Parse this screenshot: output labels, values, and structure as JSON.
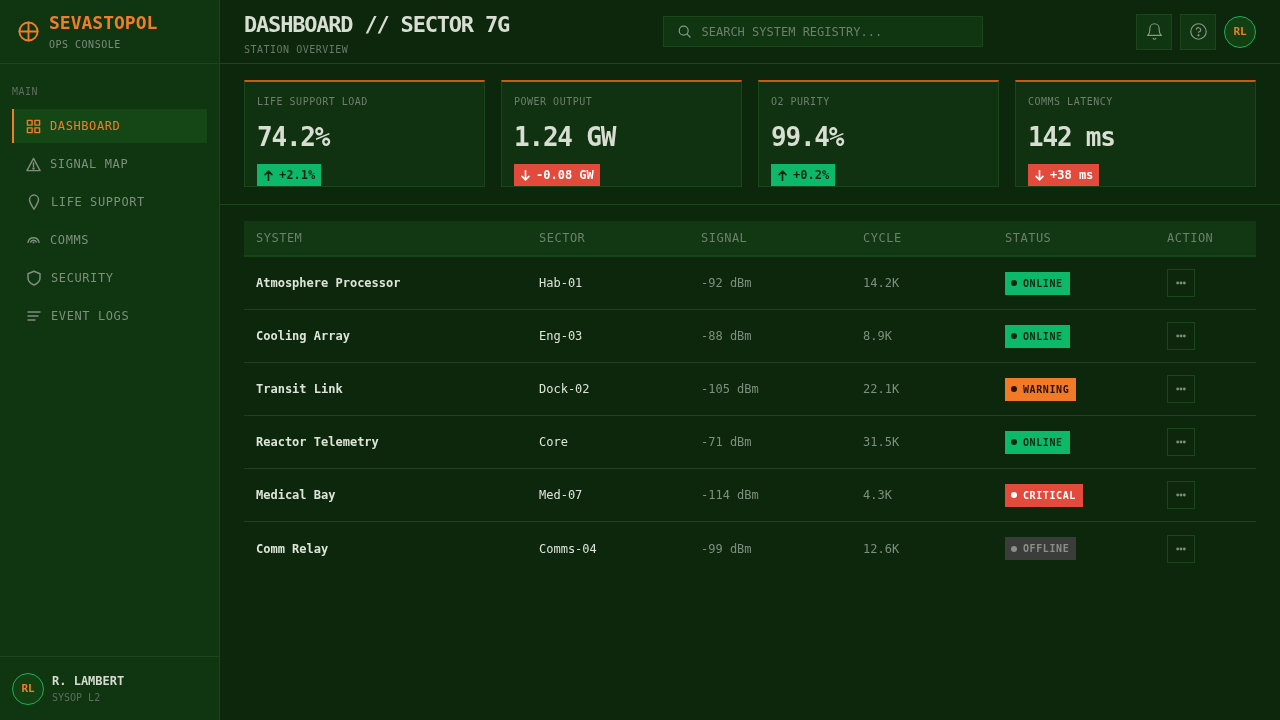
{
  "sidebar": {
    "brand": {
      "name": "SEVASTOPOL",
      "subtitle": "OPS CONSOLE"
    },
    "section": "MAIN",
    "items": [
      {
        "label": "DASHBOARD",
        "selected": true
      },
      {
        "label": "SIGNAL MAP",
        "selected": false
      },
      {
        "label": "LIFE SUPPORT",
        "selected": false
      },
      {
        "label": "COMMS",
        "selected": false
      },
      {
        "label": "SECURITY",
        "selected": false
      },
      {
        "label": "EVENT LOGS",
        "selected": false
      }
    ],
    "user": {
      "initials": "RL",
      "name": "R. LAMBERT",
      "role": "SYSOP L2"
    }
  },
  "header": {
    "title": "DASHBOARD // SECTOR 7G",
    "subtitle": "STATION OVERVIEW",
    "search": {
      "placeholder": "SEARCH SYSTEM REGISTRY..."
    },
    "avatar": "RL"
  },
  "stats": [
    {
      "label": "LIFE SUPPORT LOAD",
      "value": "74.2%",
      "delta": "+2.1%",
      "kind": "up"
    },
    {
      "label": "POWER OUTPUT",
      "value": "1.24 GW",
      "delta": "-0.08 GW",
      "kind": "down"
    },
    {
      "label": "O2 PURITY",
      "value": "99.4%",
      "delta": "+0.2%",
      "kind": "up"
    },
    {
      "label": "COMMS LATENCY",
      "value": "142 ms",
      "delta": "+38 ms",
      "kind": "down"
    }
  ],
  "table": {
    "columns": [
      "SYSTEM",
      "SECTOR",
      "SIGNAL",
      "CYCLE",
      "STATUS",
      "ACTION"
    ],
    "rows": [
      {
        "system": "Atmosphere Processor",
        "sector": "Hab-01",
        "signal": "-92 dBm",
        "cycle": "14.2K",
        "status": {
          "label": "ONLINE",
          "kind": "online"
        }
      },
      {
        "system": "Cooling Array",
        "sector": "Eng-03",
        "signal": "-88 dBm",
        "cycle": "8.9K",
        "status": {
          "label": "ONLINE",
          "kind": "online"
        }
      },
      {
        "system": "Transit Link",
        "sector": "Dock-02",
        "signal": "-105 dBm",
        "cycle": "22.1K",
        "status": {
          "label": "WARNING",
          "kind": "warning"
        }
      },
      {
        "system": "Reactor Telemetry",
        "sector": "Core",
        "signal": "-71 dBm",
        "cycle": "31.5K",
        "status": {
          "label": "ONLINE",
          "kind": "online"
        }
      },
      {
        "system": "Medical Bay",
        "sector": "Med-07",
        "signal": "-114 dBm",
        "cycle": "4.3K",
        "status": {
          "label": "CRITICAL",
          "kind": "critical"
        }
      },
      {
        "system": "Comm Relay",
        "sector": "Comms-04",
        "signal": "-99 dBm",
        "cycle": "12.6K",
        "status": {
          "label": "OFFLINE",
          "kind": "offline"
        }
      }
    ]
  }
}
